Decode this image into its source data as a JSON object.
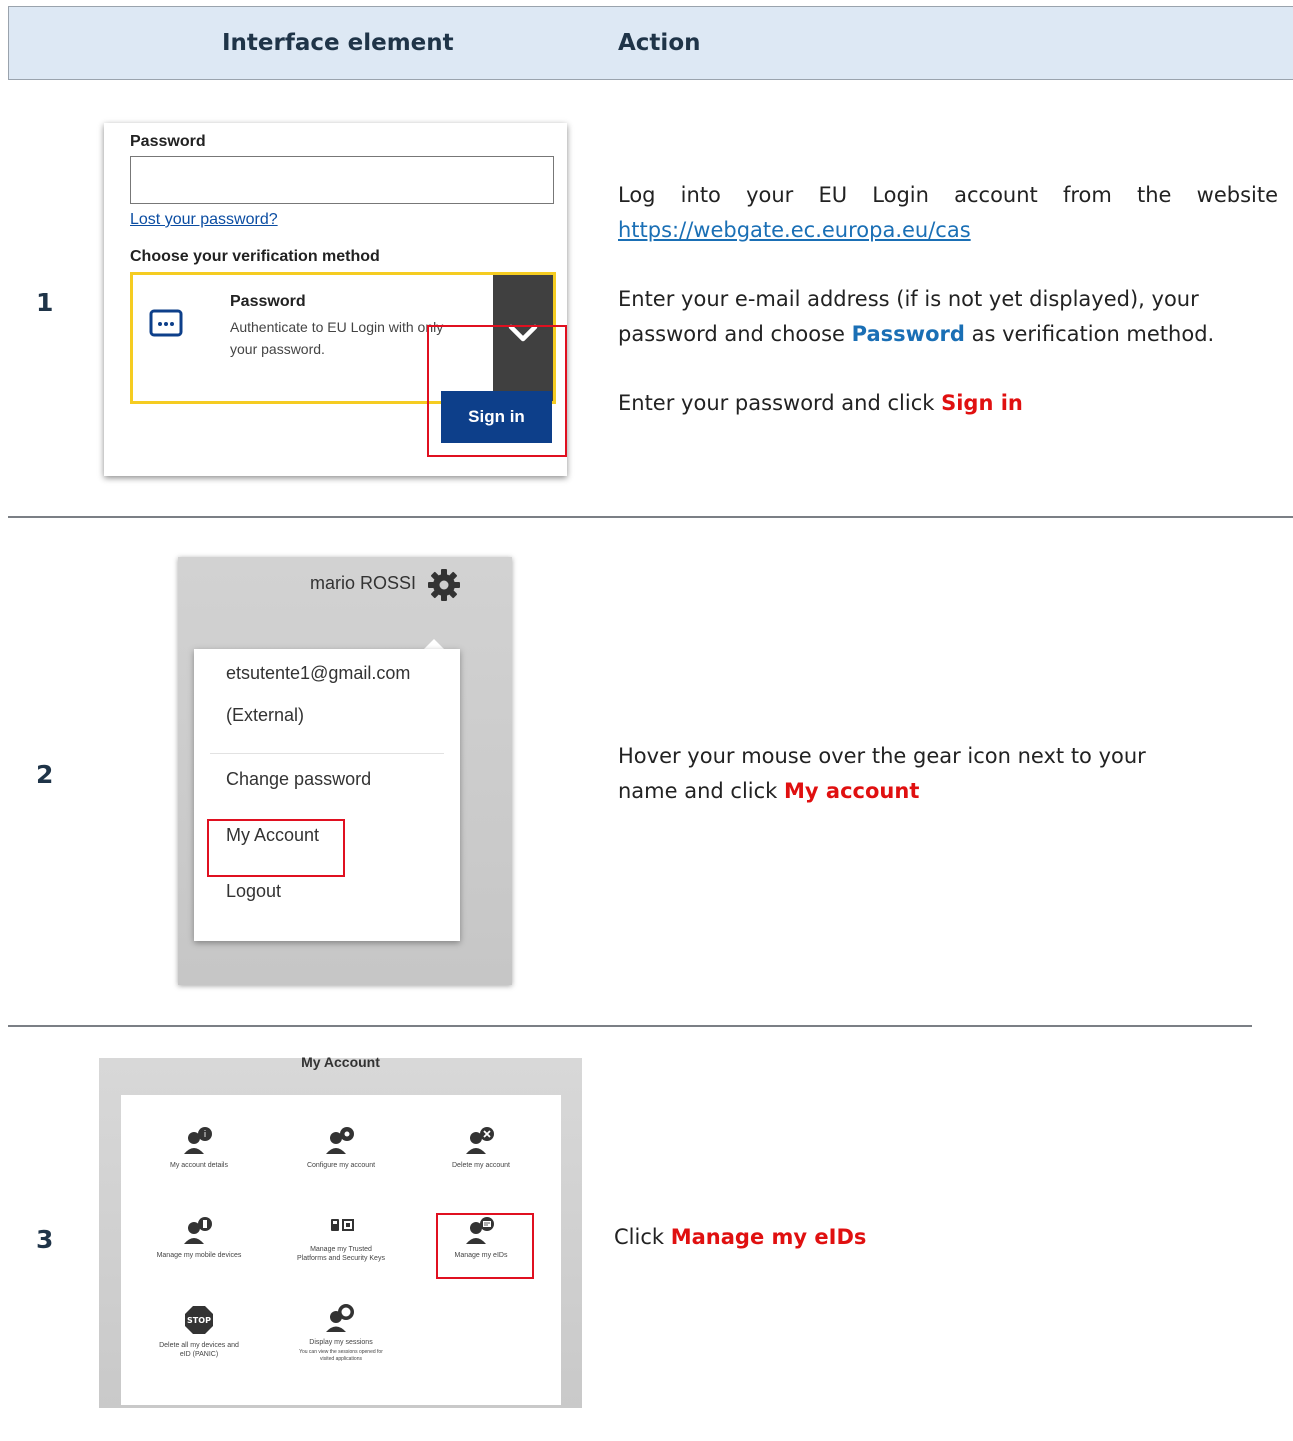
{
  "header": {
    "col_interface": "Interface element",
    "col_action": "Action"
  },
  "rows": [
    {
      "number": "1",
      "action": {
        "p1_text": "Log into your EU Login account from the website",
        "p1_link": "https://webgate.ec.europa.eu/cas",
        "p2_pre": "Enter your e-mail address (if is not yet displayed), your password and choose",
        "p2_highlight": "Password",
        "p2_post": "as verification method.",
        "p3_pre": "Enter your password and click",
        "p3_highlight": "Sign in"
      }
    },
    {
      "number": "2",
      "action": {
        "line1": "Hover your mouse over the gear icon next to your",
        "line2_pre": "name and click",
        "line2_highlight": "My account"
      }
    },
    {
      "number": "3",
      "action": {
        "pre": "Click",
        "highlight": "Manage my eIDs"
      }
    }
  ],
  "login_form": {
    "password_label": "Password",
    "password_value": "",
    "lost_password_link": "Lost your password?",
    "verification_label": "Choose your verification method",
    "method_title": "Password",
    "method_desc_line1": "Authenticate to EU Login with only",
    "method_desc_line2": "your password.",
    "method_icon": "password-dots-icon",
    "dropdown_icon": "chevron-down-icon",
    "sign_in_label": "Sign in",
    "highlight_color": "#f5cc21",
    "button_color": "#0d3f8a"
  },
  "user_menu": {
    "user_name": "mario ROSSI",
    "gear_icon": "gear-icon",
    "email": "etsutente1@gmail.com",
    "account_type": "(External)",
    "items": [
      "Change password",
      "My Account",
      "Logout"
    ]
  },
  "my_account": {
    "title": "My Account",
    "tiles": [
      {
        "label": "My account details",
        "icon": "user-info-icon"
      },
      {
        "label": "Configure my account",
        "icon": "user-settings-icon"
      },
      {
        "label": "Delete my account",
        "icon": "user-delete-icon"
      },
      {
        "label": "Manage my mobile devices",
        "icon": "user-mobile-icon"
      },
      {
        "label": "Manage my Trusted Platforms and Security Keys",
        "icon": "security-keys-icon"
      },
      {
        "label": "Manage my eIDs",
        "icon": "user-eid-icon"
      },
      {
        "label": "Delete all my devices and eID (PANIC)",
        "icon": "stop-icon"
      },
      {
        "label": "Display my sessions",
        "icon": "user-sessions-icon"
      }
    ],
    "sessions_desc": "You can view the sessions opened for visited applications",
    "stop_text": "STOP"
  }
}
